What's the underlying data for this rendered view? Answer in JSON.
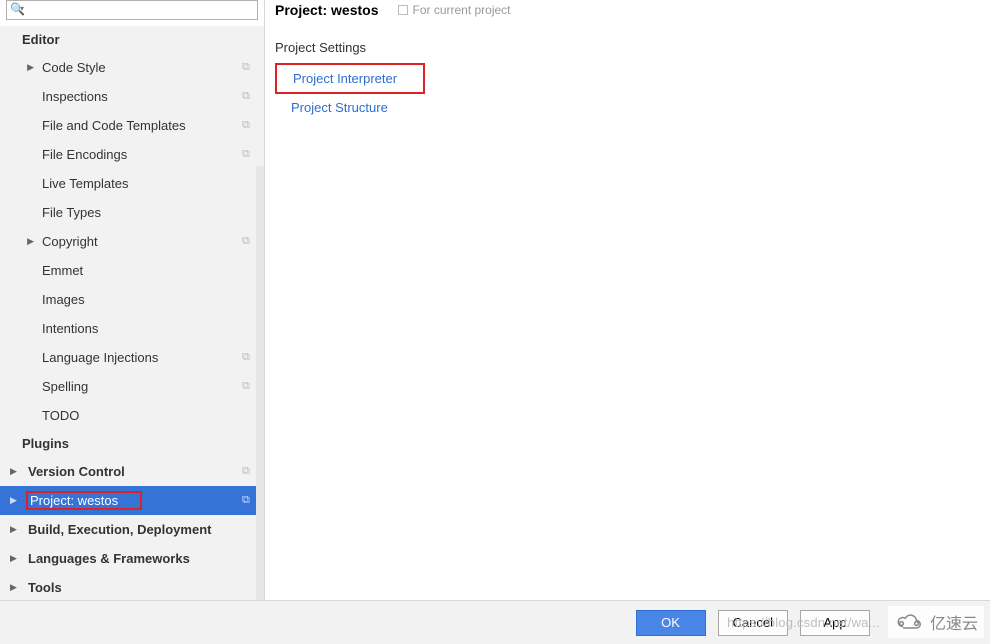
{
  "search": {
    "placeholder": ""
  },
  "sidebar": {
    "editor_head": "Editor",
    "items": [
      {
        "label": "Code Style",
        "caret": true,
        "copy": true,
        "indent": false
      },
      {
        "label": "Inspections",
        "caret": false,
        "copy": true,
        "indent": true
      },
      {
        "label": "File and Code Templates",
        "caret": false,
        "copy": true,
        "indent": true
      },
      {
        "label": "File Encodings",
        "caret": false,
        "copy": true,
        "indent": true
      },
      {
        "label": "Live Templates",
        "caret": false,
        "copy": false,
        "indent": true
      },
      {
        "label": "File Types",
        "caret": false,
        "copy": false,
        "indent": true
      },
      {
        "label": "Copyright",
        "caret": true,
        "copy": true,
        "indent": false
      },
      {
        "label": "Emmet",
        "caret": false,
        "copy": false,
        "indent": true
      },
      {
        "label": "Images",
        "caret": false,
        "copy": false,
        "indent": true
      },
      {
        "label": "Intentions",
        "caret": false,
        "copy": false,
        "indent": true
      },
      {
        "label": "Language Injections",
        "caret": false,
        "copy": true,
        "indent": true
      },
      {
        "label": "Spelling",
        "caret": false,
        "copy": true,
        "indent": true
      },
      {
        "label": "TODO",
        "caret": false,
        "copy": false,
        "indent": true
      }
    ],
    "plugins_head": "Plugins",
    "roots": [
      {
        "label": "Version Control",
        "copy": true,
        "selected": false,
        "red": false
      },
      {
        "label": "Project: westos",
        "copy": true,
        "selected": true,
        "red": true
      },
      {
        "label": "Build, Execution, Deployment",
        "copy": false,
        "selected": false,
        "red": false
      },
      {
        "label": "Languages & Frameworks",
        "copy": false,
        "selected": false,
        "red": false
      },
      {
        "label": "Tools",
        "copy": false,
        "selected": false,
        "red": false
      }
    ]
  },
  "main": {
    "title": "Project: westos",
    "subtitle": "For current project",
    "settings_head": "Project Settings",
    "links": [
      {
        "label": "Project Interpreter",
        "boxed": true
      },
      {
        "label": "Project Structure",
        "boxed": false
      }
    ]
  },
  "bottom": {
    "ok": "OK",
    "cancel": "Cancel",
    "apply": "App",
    "overlay_url": "https://blog.csdn.net/wa..."
  },
  "watermark": "亿速云"
}
